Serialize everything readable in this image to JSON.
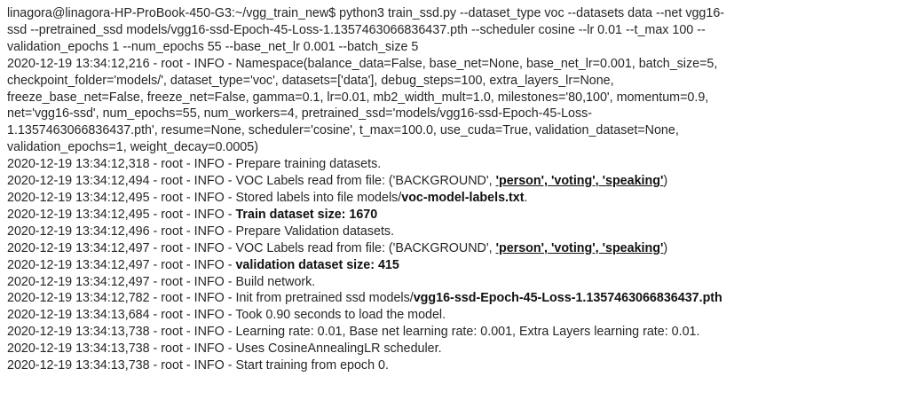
{
  "terminal": {
    "command": {
      "l1": "linagora@linagora-HP-ProBook-450-G3:~/vgg_train_new$ python3 train_ssd.py --dataset_type voc --datasets data --net vgg16-",
      "l2": "ssd --pretrained_ssd models/vgg16-ssd-Epoch-45-Loss-1.1357463066836437.pth --scheduler cosine --lr 0.01 --t_max 100 --",
      "l3": "validation_epochs 1 --num_epochs 55 --base_net_lr 0.001 --batch_size 5"
    },
    "namespace": {
      "l1": "2020-12-19 13:34:12,216 - root - INFO - Namespace(balance_data=False, base_net=None, base_net_lr=0.001, batch_size=5,",
      "l2": "checkpoint_folder='models/', dataset_type='voc', datasets=['data'], debug_steps=100, extra_layers_lr=None,",
      "l3": "freeze_base_net=False, freeze_net=False, gamma=0.1, lr=0.01, mb2_width_mult=1.0, milestones='80,100', momentum=0.9,",
      "l4": "net='vgg16-ssd', num_epochs=55, num_workers=4, pretrained_ssd='models/vgg16-ssd-Epoch-45-Loss-",
      "l5": "1.1357463066836437.pth', resume=None, scheduler='cosine', t_max=100.0, use_cuda=True, validation_dataset=None,",
      "l6": "validation_epochs=1, weight_decay=0.0005)"
    },
    "log": {
      "prepare_train": "2020-12-19 13:34:12,318 - root - INFO - Prepare training datasets.",
      "labels_train_prefix": "2020-12-19 13:34:12,494 - root - INFO - VOC Labels read from file: ('BACKGROUND', ",
      "labels_train_bold": "'person', 'voting', 'speaking'",
      "labels_train_suffix": ")",
      "stored_prefix": "2020-12-19 13:34:12,495 - root - INFO - Stored labels into file models/",
      "stored_bold": "voc-model-labels.txt",
      "stored_suffix": ".",
      "train_size_prefix": "2020-12-19 13:34:12,495 - root - INFO - ",
      "train_size_bold": "Train dataset size: 1670",
      "prepare_val": "2020-12-19 13:34:12,496 - root - INFO - Prepare Validation datasets.",
      "labels_val_prefix": "2020-12-19 13:34:12,497 - root - INFO - VOC Labels read from file: ('BACKGROUND', ",
      "labels_val_bold": "'person', 'voting', 'speaking'",
      "labels_val_suffix": ")",
      "val_size_prefix": "2020-12-19 13:34:12,497 - root - INFO - ",
      "val_size_bold": "validation dataset size: 415",
      "build": "2020-12-19 13:34:12,497 - root - INFO - Build network.",
      "init_prefix": "2020-12-19 13:34:12,782 - root - INFO - Init from pretrained ssd models/",
      "init_bold": "vgg16-ssd-Epoch-45-Loss-1.1357463066836437.pth",
      "took": "2020-12-19 13:34:13,684 - root - INFO - Took 0.90 seconds to load the model.",
      "lr": "2020-12-19 13:34:13,738 - root - INFO - Learning rate: 0.01, Base net learning rate: 0.001, Extra Layers learning rate: 0.01.",
      "scheduler": "2020-12-19 13:34:13,738 - root - INFO - Uses CosineAnnealingLR scheduler.",
      "start": "2020-12-19 13:34:13,738 - root - INFO - Start training from epoch 0."
    }
  }
}
